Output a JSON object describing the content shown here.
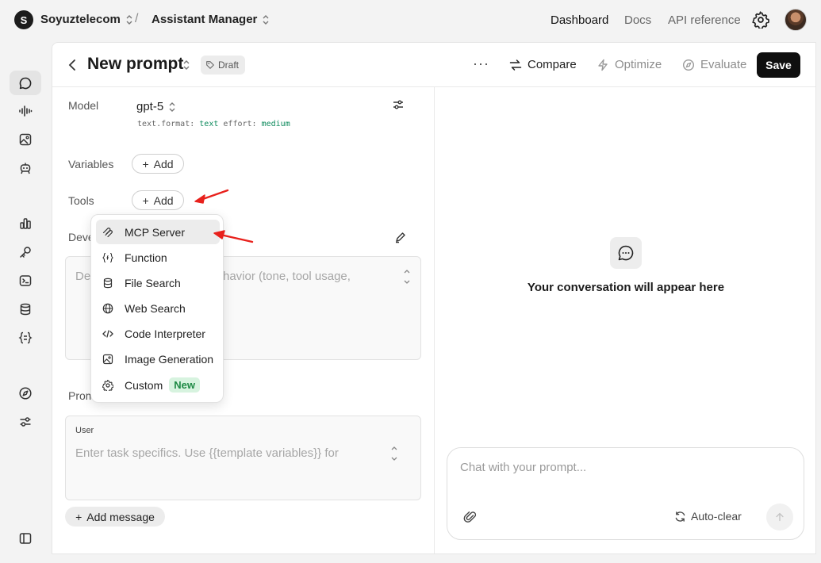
{
  "topbar": {
    "org_initial": "S",
    "org_name": "Soyuztelecom",
    "separator": "/",
    "project_name": "Assistant Manager",
    "links": [
      "Dashboard",
      "Docs",
      "API reference"
    ]
  },
  "header": {
    "title": "New prompt",
    "badge": "Draft",
    "more": "···",
    "compare": "Compare",
    "optimize": "Optimize",
    "evaluate": "Evaluate",
    "save": "Save"
  },
  "form": {
    "model_label": "Model",
    "model_value": "gpt-5",
    "format_key": "text.format:",
    "format_val": "text",
    "effort_key": "effort:",
    "effort_val": "medium",
    "variables_label": "Variables",
    "tools_label": "Tools",
    "add_label": "Add",
    "developer_label": "Deve",
    "developer_placeholder_left": "De",
    "developer_placeholder_right": "havior (tone, tool usage,",
    "prompt_label": "Prom",
    "user_label": "User",
    "user_placeholder": "Enter task specifics. Use {{template variables}} for",
    "add_message": "Add message"
  },
  "tools_menu": {
    "items": [
      {
        "label": "MCP Server",
        "icon": "mcp-icon"
      },
      {
        "label": "Function",
        "icon": "function-icon"
      },
      {
        "label": "File Search",
        "icon": "database-icon"
      },
      {
        "label": "Web Search",
        "icon": "globe-icon"
      },
      {
        "label": "Code Interpreter",
        "icon": "code-icon"
      },
      {
        "label": "Image Generation",
        "icon": "image-icon"
      },
      {
        "label": "Custom",
        "icon": "gear-icon",
        "badge": "New"
      }
    ]
  },
  "chat": {
    "empty_text": "Your conversation will appear here",
    "placeholder": "Chat with your prompt...",
    "autoclear": "Auto-clear"
  },
  "colors": {
    "accent_green": "#0d8a5c",
    "annotation_red": "#e8211c",
    "save_bg": "#0f0f0f"
  }
}
